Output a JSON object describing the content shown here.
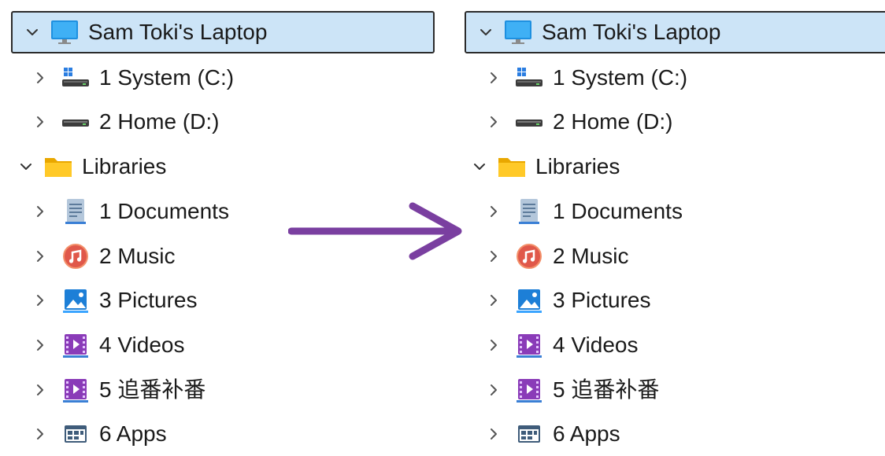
{
  "arrow_color": "#7a3fa0",
  "panes": [
    {
      "id": "left",
      "items": [
        {
          "label": "Sam Toki's Laptop",
          "icon": "monitor-icon",
          "expanded": true,
          "selected": true
        },
        {
          "label": "1 System (C:)",
          "icon": "system-drive-icon",
          "expanded": false
        },
        {
          "label": "2 Home (D:)",
          "icon": "drive-icon",
          "expanded": false
        },
        {
          "label": "Libraries",
          "icon": "folder-icon",
          "expanded": true
        },
        {
          "label": "1 Documents",
          "icon": "documents-icon",
          "expanded": false
        },
        {
          "label": "2 Music",
          "icon": "music-icon",
          "expanded": false
        },
        {
          "label": "3 Pictures",
          "icon": "pictures-icon",
          "expanded": false
        },
        {
          "label": "4 Videos",
          "icon": "videos-icon",
          "expanded": false
        },
        {
          "label": "5 追番补番",
          "icon": "videos-icon",
          "expanded": false
        },
        {
          "label": "6 Apps",
          "icon": "apps-icon",
          "expanded": false
        }
      ]
    },
    {
      "id": "right",
      "items": [
        {
          "label": "Sam Toki's Laptop",
          "icon": "monitor-icon",
          "expanded": true,
          "selected": true
        },
        {
          "label": "1 System (C:)",
          "icon": "system-drive-icon",
          "expanded": false
        },
        {
          "label": "2 Home (D:)",
          "icon": "drive-icon",
          "expanded": false
        },
        {
          "label": "Libraries",
          "icon": "folder-icon",
          "expanded": true
        },
        {
          "label": "1 Documents",
          "icon": "documents-icon",
          "expanded": false
        },
        {
          "label": "2 Music",
          "icon": "music-icon",
          "expanded": false
        },
        {
          "label": "3 Pictures",
          "icon": "pictures-icon",
          "expanded": false
        },
        {
          "label": "4 Videos",
          "icon": "videos-icon",
          "expanded": false
        },
        {
          "label": "5 追番补番",
          "icon": "videos-icon",
          "expanded": false
        },
        {
          "label": "6 Apps",
          "icon": "apps-icon",
          "expanded": false
        }
      ]
    }
  ]
}
